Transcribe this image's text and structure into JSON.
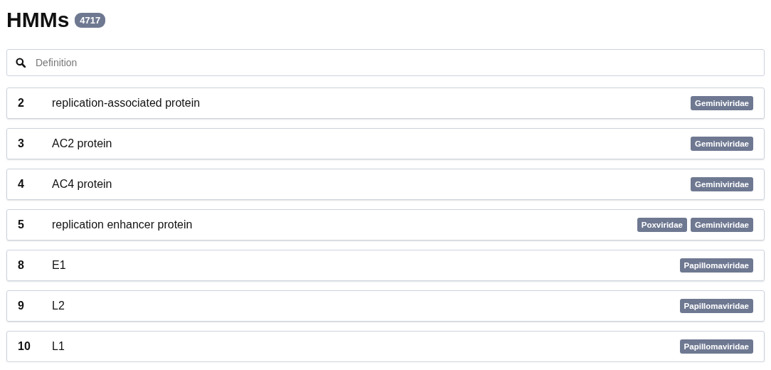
{
  "header": {
    "title": "HMMs",
    "count": "4717"
  },
  "search": {
    "placeholder": "Definition"
  },
  "rows": [
    {
      "number": "2",
      "definition": "replication-associated protein",
      "families": [
        "Geminiviridae"
      ]
    },
    {
      "number": "3",
      "definition": "AC2 protein",
      "families": [
        "Geminiviridae"
      ]
    },
    {
      "number": "4",
      "definition": "AC4 protein",
      "families": [
        "Geminiviridae"
      ]
    },
    {
      "number": "5",
      "definition": "replication enhancer protein",
      "families": [
        "Poxviridae",
        "Geminiviridae"
      ]
    },
    {
      "number": "8",
      "definition": "E1",
      "families": [
        "Papillomaviridae"
      ]
    },
    {
      "number": "9",
      "definition": "L2",
      "families": [
        "Papillomaviridae"
      ]
    },
    {
      "number": "10",
      "definition": "L1",
      "families": [
        "Papillomaviridae"
      ]
    }
  ]
}
